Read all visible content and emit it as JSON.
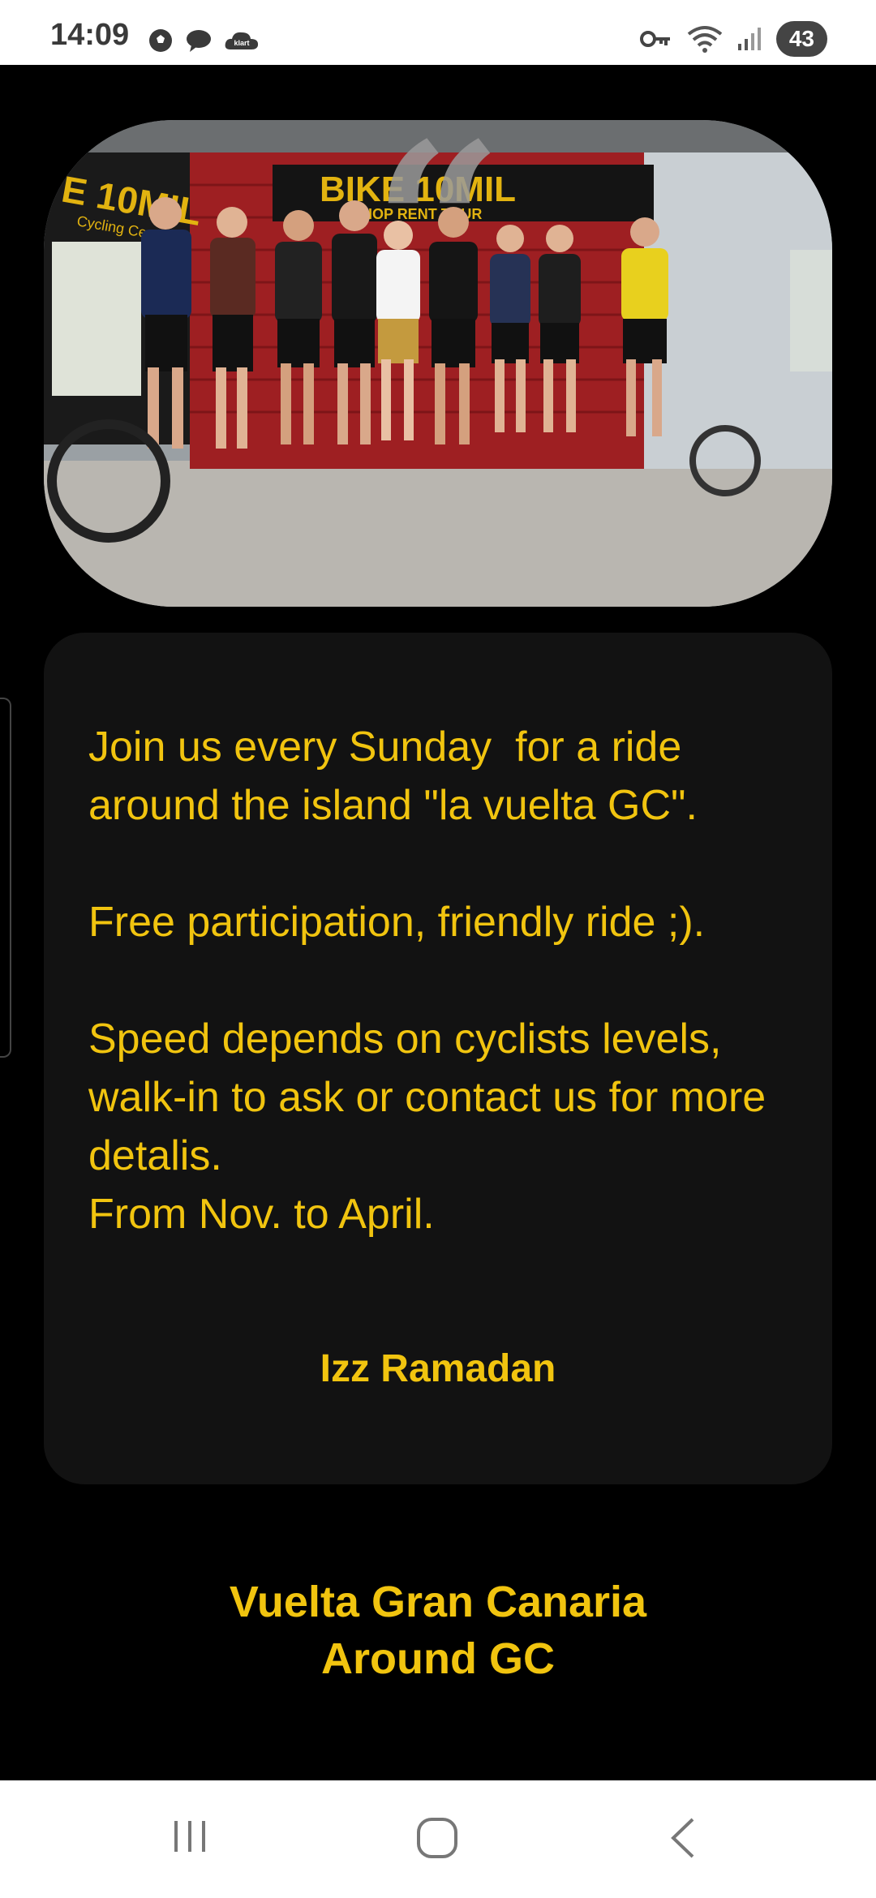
{
  "status_bar": {
    "time": "14:09",
    "left_icons": [
      "soccer-ball-icon",
      "chat-bubble-icon",
      "klart-cloud-icon"
    ],
    "right_icons": [
      "vpn-key-icon",
      "wifi-icon",
      "signal-icon"
    ],
    "battery": "43",
    "klart_label": "klart"
  },
  "photo": {
    "sign_text": "BIKE 10MIL",
    "sign_sub": "SHOP RENT TOUR",
    "side_sign": "E 10MIL",
    "side_sub": "Cycling Center"
  },
  "card": {
    "text": "Join us every Sunday  for a ride around the island \"la vuelta GC\".\n\nFree participation, friendly ride ;).\n\nSpeed depends on cyclists levels, walk-in to ask or contact us for more detalis.\nFrom Nov. to April.",
    "author": "Izz Ramadan"
  },
  "footer": {
    "line1": "Vuelta Gran Canaria",
    "line2": "Around GC"
  },
  "nav": {
    "icons": [
      "recent-apps-icon",
      "home-icon",
      "back-icon"
    ]
  },
  "colors": {
    "accent": "#f1c40f",
    "card_bg": "#121212",
    "background": "#000000"
  }
}
